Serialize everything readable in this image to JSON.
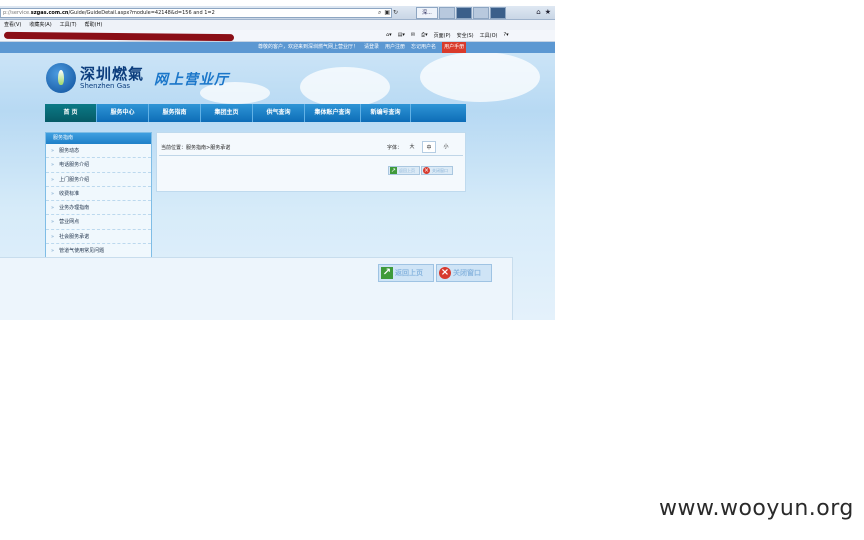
{
  "browser": {
    "url_prefix": "p://service.",
    "url_host": "szgas.com.cn",
    "url_path": "/Guide/GuideDetail.aspx?module=42148&d=156 and 1=2",
    "tabs": [
      "深...",
      "",
      "",
      "",
      ""
    ],
    "menu": [
      "查看(V)",
      "收藏夹(A)",
      "工具(T)",
      "帮助(H)"
    ],
    "commands": [
      "页面(P)",
      "安全(S)",
      "工具(O)"
    ]
  },
  "site": {
    "toplinks": [
      "尊敬的客户，欢迎来到深圳燃气网上营业厅！",
      "请登录",
      "用户注册",
      "忘记用户名",
      "用户手册"
    ],
    "logo_cn": "深圳燃氣",
    "logo_en": "Shenzhen Gas",
    "portal_title": "网上营业厅",
    "nav": [
      "首  页",
      "服务中心",
      "服务指南",
      "集团主页",
      "供气查询",
      "集体账户查询",
      "新编号查询"
    ],
    "sidebar": {
      "title": "服务指南",
      "items": [
        "服务动态",
        "电话服务介绍",
        "上门服务介绍",
        "收费标准",
        "业务办理指南",
        "营业网点",
        "社会服务承诺",
        "管道气使用常见问题"
      ]
    },
    "content": {
      "breadcrumb": "当前位置：服务指南>服务承诺",
      "font_label": "字体：",
      "font_sizes": [
        "大",
        "中",
        "小"
      ],
      "back_label": "返回上页",
      "close_label": "关闭窗口"
    }
  },
  "watermark": "www.wooyun.org"
}
